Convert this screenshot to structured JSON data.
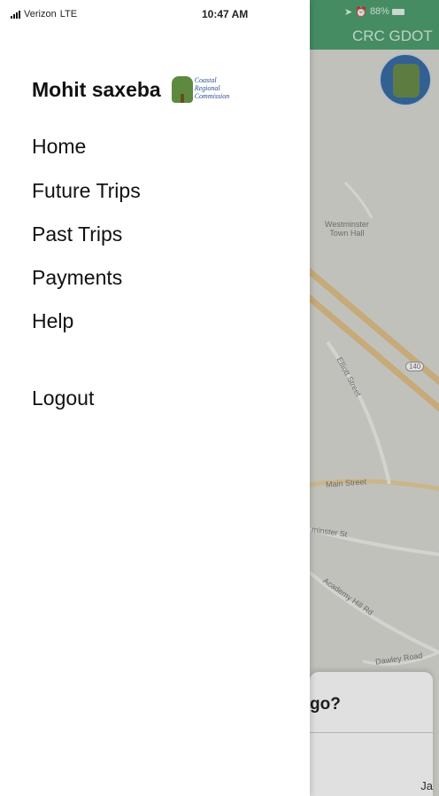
{
  "status_bar": {
    "carrier": "Verizon",
    "network": "LTE",
    "time": "10:47 AM",
    "right_status": "88%"
  },
  "background": {
    "header_title": "CRC GDOT",
    "map_labels": {
      "townhall": "Westminster\nTown Hall",
      "elliott": "Elliott Street",
      "main": "Main Street",
      "westminster": "minster St",
      "academy": "Academy Hill Rd",
      "dawley": "Dawley Road",
      "route": "140"
    },
    "sheet_prompt": "go?",
    "sheet_bottom": "Ja"
  },
  "drawer": {
    "user_name": "Mohit saxeba",
    "logo_text": "Coastal\nRegional\nCommission",
    "menu": [
      {
        "label": "Home"
      },
      {
        "label": "Future Trips"
      },
      {
        "label": "Past Trips"
      },
      {
        "label": "Payments"
      },
      {
        "label": "Help"
      },
      {
        "label": "Logout"
      }
    ]
  },
  "colors": {
    "accent_green": "#4fa071",
    "map_bg": "#dcdcd6",
    "road_orange": "#e2c28a"
  }
}
